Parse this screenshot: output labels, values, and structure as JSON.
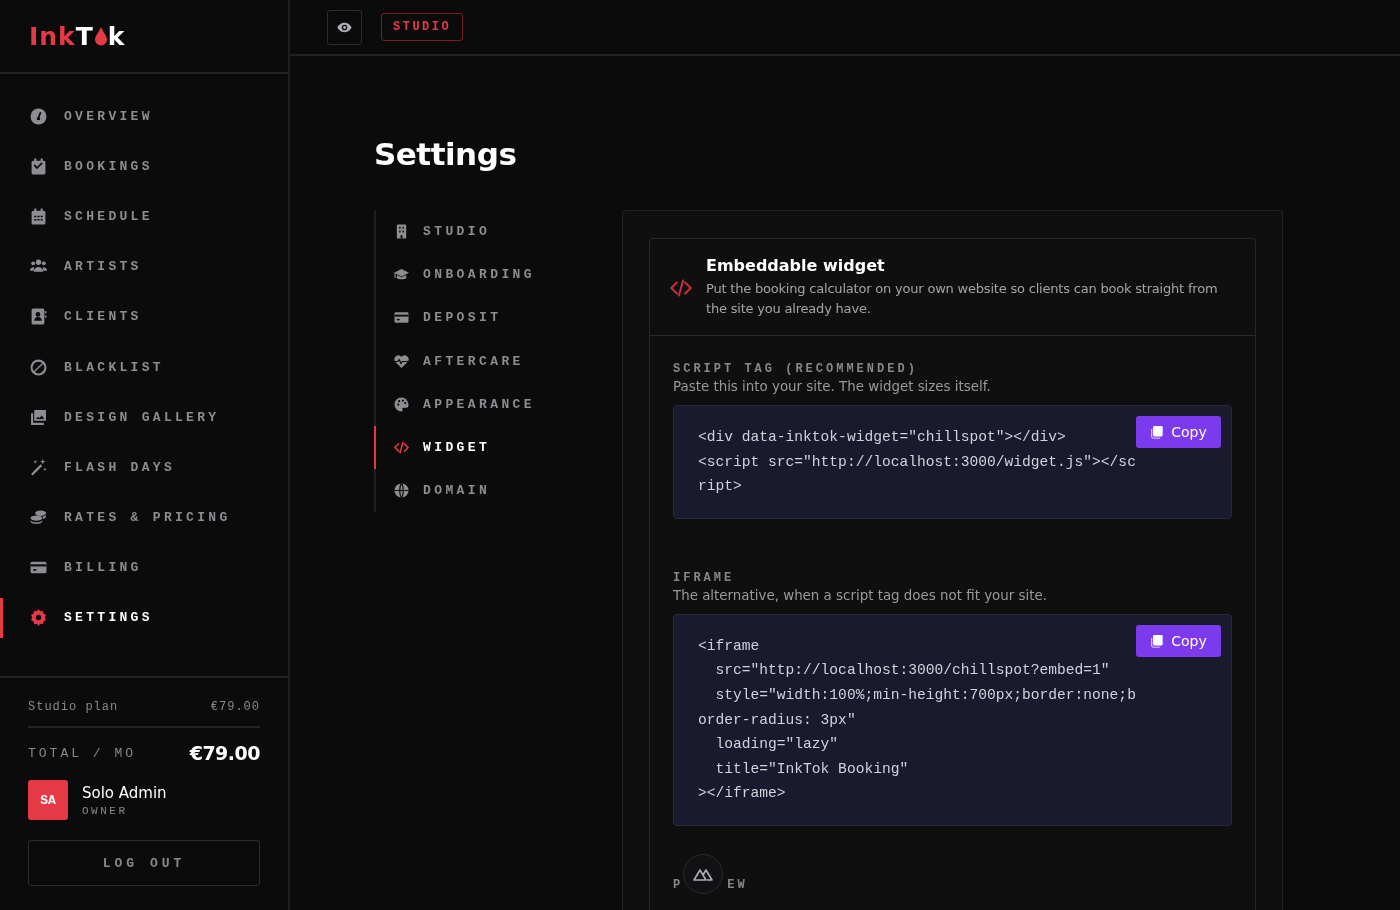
{
  "logo": {
    "prefix": "Ink",
    "suffix": "T",
    "end": "k"
  },
  "nav": [
    {
      "label": "OVERVIEW",
      "selected": false
    },
    {
      "label": "BOOKINGS",
      "selected": false
    },
    {
      "label": "SCHEDULE",
      "selected": false
    },
    {
      "label": "ARTISTS",
      "selected": false
    },
    {
      "label": "CLIENTS",
      "selected": false
    },
    {
      "label": "BLACKLIST",
      "selected": false
    },
    {
      "label": "DESIGN GALLERY",
      "selected": false
    },
    {
      "label": "FLASH DAYS",
      "selected": false
    },
    {
      "label": "RATES & PRICING",
      "selected": false
    },
    {
      "label": "BILLING",
      "selected": false
    },
    {
      "label": "SETTINGS",
      "selected": true
    }
  ],
  "plan": {
    "name": "Studio plan",
    "price": "€79.00",
    "total_label": "TOTAL / MO",
    "total": "€79.00"
  },
  "user": {
    "initials": "SA",
    "name": "Solo Admin",
    "role": "OWNER"
  },
  "logout": "LOG OUT",
  "topbar": {
    "badge": "STUDIO"
  },
  "title": "Settings",
  "subnav": [
    {
      "label": "STUDIO",
      "selected": false
    },
    {
      "label": "ONBOARDING",
      "selected": false
    },
    {
      "label": "DEPOSIT",
      "selected": false
    },
    {
      "label": "AFTERCARE",
      "selected": false
    },
    {
      "label": "APPEARANCE",
      "selected": false
    },
    {
      "label": "WIDGET",
      "selected": true
    },
    {
      "label": "DOMAIN",
      "selected": false
    }
  ],
  "widget": {
    "title": "Embeddable widget",
    "description": "Put the booking calculator on your own website so clients can book straight from the site you already have.",
    "sections": [
      {
        "label": "SCRIPT TAG (RECOMMENDED)",
        "hint": "Paste this into your site. The widget sizes itself.",
        "code": "<div data-inktok-widget=\"chillspot\"></div>\n<script src=\"http://localhost:3000/widget.js\"></script>",
        "button": "Copy"
      },
      {
        "label": "IFRAME",
        "hint": "The alternative, when a script tag does not fit your site.",
        "code": "<iframe\n  src=\"http://localhost:3000/chillspot?embed=1\"\n  style=\"width:100%;min-height:700px;border:none;border-radius: 3px\"\n  loading=\"lazy\"\n  title=\"InkTok Booking\"\n></iframe>",
        "button": "Copy"
      }
    ],
    "cut_label": {
      "start": "P",
      "end": "EW"
    }
  }
}
